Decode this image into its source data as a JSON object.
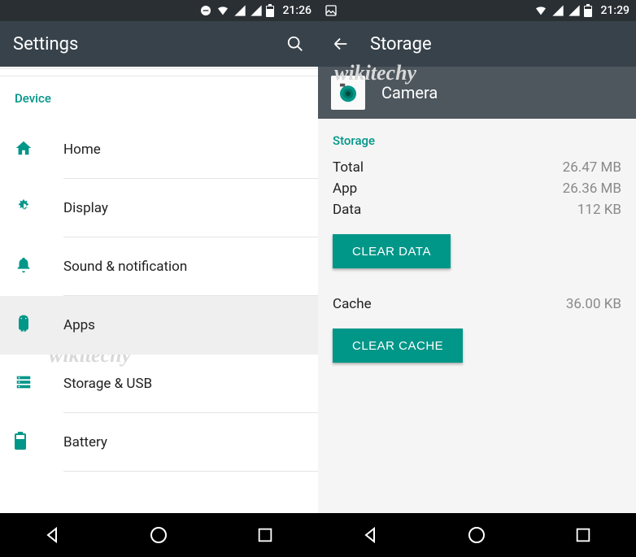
{
  "left": {
    "status": {
      "time": "21:26"
    },
    "appbar": {
      "title": "Settings"
    },
    "section_label": "Device",
    "items": [
      {
        "label": "Home"
      },
      {
        "label": "Display"
      },
      {
        "label": "Sound & notification"
      },
      {
        "label": "Apps"
      },
      {
        "label": "Storage & USB"
      },
      {
        "label": "Battery"
      }
    ]
  },
  "right": {
    "status": {
      "time": "21:29"
    },
    "appbar": {
      "title": "Storage"
    },
    "app": {
      "name": "Camera"
    },
    "storage_label": "Storage",
    "rows": {
      "total_k": "Total",
      "total_v": "26.47 MB",
      "app_k": "App",
      "app_v": "26.36 MB",
      "data_k": "Data",
      "data_v": "112 KB"
    },
    "clear_data_btn": "CLEAR DATA",
    "cache_k": "Cache",
    "cache_v": "36.00 KB",
    "clear_cache_btn": "CLEAR CACHE"
  },
  "watermark": "wikitechy"
}
